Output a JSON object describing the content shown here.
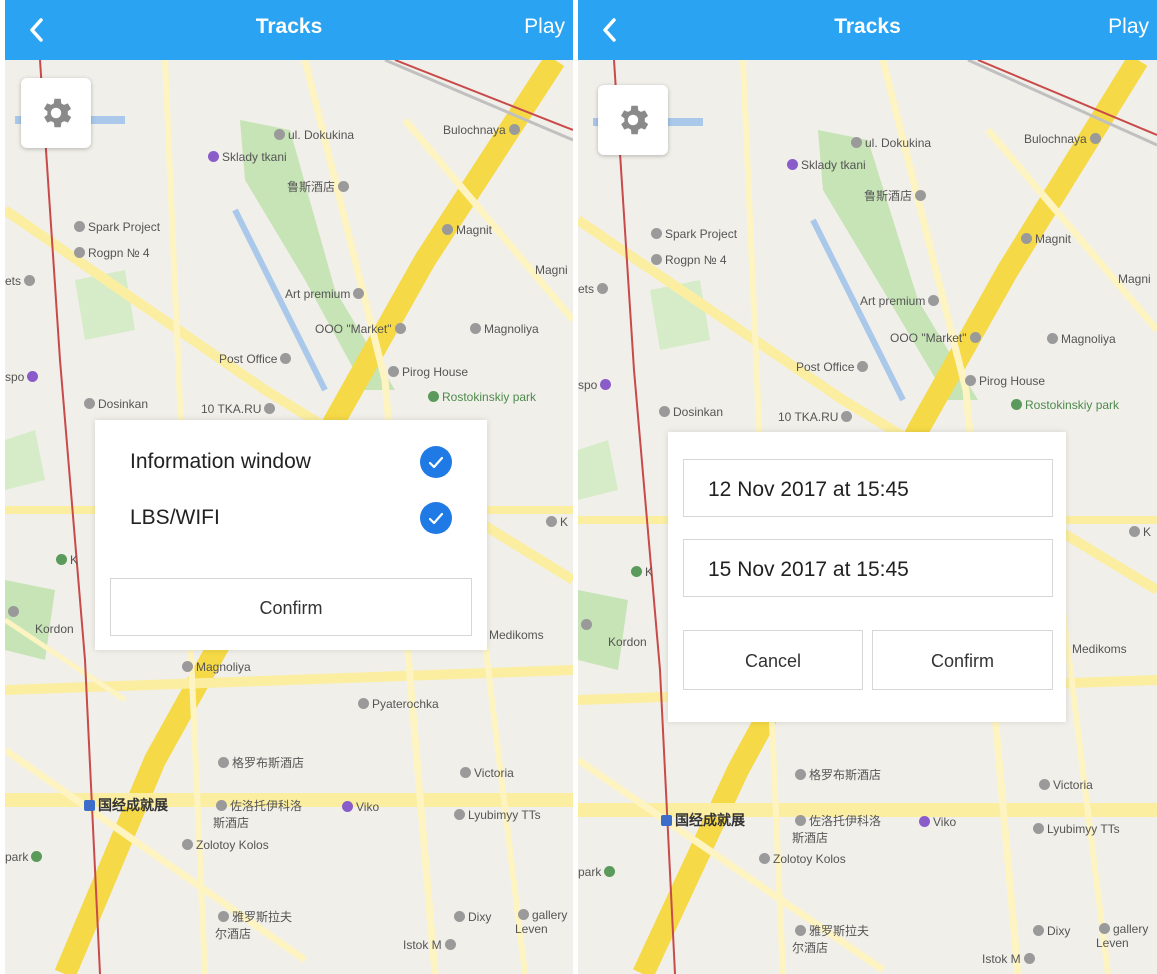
{
  "left": {
    "header": {
      "title": "Tracks",
      "play_label": "Play"
    },
    "settings": {
      "options": [
        {
          "label": "Information window",
          "checked": true
        },
        {
          "label": "LBS/WIFI",
          "checked": true
        }
      ],
      "confirm_label": "Confirm"
    }
  },
  "right": {
    "header": {
      "title": "Tracks",
      "play_label": "Play"
    },
    "date_picker": {
      "start": "12 Nov 2017 at 15:45",
      "end": "15 Nov 2017 at 15:45",
      "cancel_label": "Cancel",
      "confirm_label": "Confirm"
    }
  },
  "map_labels": {
    "dokukina": "ul. Dokukina",
    "bulochnaya": "Bulochnaya",
    "sklady": "Sklady tkani",
    "lusi": "鲁斯酒店",
    "spark": "Spark Project",
    "rogpn": "Rogpn № 4",
    "magnit": "Magnit",
    "magni": "Magni",
    "ets": "ets",
    "art": "Art premium",
    "ooo": "OOO \"Market\"",
    "magnoliya": "Magnoliya",
    "post": "Post Office",
    "pirog": "Pirog House",
    "spo": "spo",
    "dosinkan": "Dosinkan",
    "tka": "10 TKA.RU",
    "rostok": "Rostokinskiy park",
    "k": "K",
    "kordon": "Kordon",
    "medikoms": "Medikoms",
    "pyaterochka": "Pyaterochka",
    "geluo": "格罗布斯酒店",
    "victoria": "Victoria",
    "guojing": "国经成就展",
    "viko": "Viko",
    "lyubimyy": "Lyubimyy TTs",
    "zuoxi": "佐洛托伊科洛斯酒店",
    "zolotoy": "Zolotoy Kolos",
    "park": "park",
    "dixy": "Dixy",
    "yaluo": "雅罗斯拉夫尔酒店",
    "gallery": "gallery Leven",
    "istok": "Istok M"
  },
  "colors": {
    "header": "#2aa3f3",
    "check": "#1f7ae6",
    "map_bg": "#f1efe9",
    "road_major": "#f5d946",
    "park": "#c6e4b5"
  },
  "icons": {
    "back": "chevron-left-icon",
    "settings": "gear-icon",
    "check": "check-icon"
  }
}
